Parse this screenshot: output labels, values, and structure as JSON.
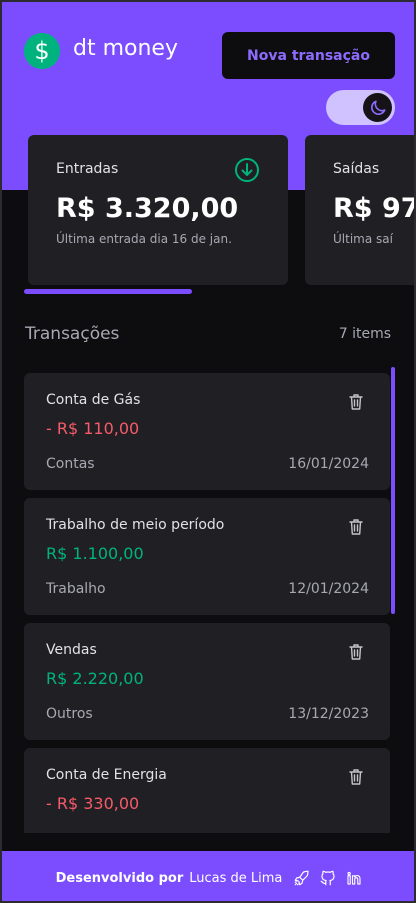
{
  "app": {
    "name": "dt money",
    "logo_symbol": "$"
  },
  "header": {
    "new_transaction_label": "Nova transação",
    "theme_toggle_icon": "moon-icon"
  },
  "summary": {
    "cards": [
      {
        "label": "Entradas",
        "value": "R$ 3.320,00",
        "sub": "Última entrada dia 16 de jan.",
        "icon": "arrow-down-circle-icon"
      },
      {
        "label": "Saídas",
        "value": "R$ 97",
        "sub": "Última saí"
      }
    ]
  },
  "transactions": {
    "title": "Transações",
    "count": "7 items",
    "items": [
      {
        "description": "Conta de Gás",
        "amount": "- R$ 110,00",
        "type": "out",
        "category": "Contas",
        "date": "16/01/2024"
      },
      {
        "description": "Trabalho de meio período",
        "amount": "R$ 1.100,00",
        "type": "in",
        "category": "Trabalho",
        "date": "12/01/2024"
      },
      {
        "description": "Vendas",
        "amount": "R$ 2.220,00",
        "type": "in",
        "category": "Outros",
        "date": "13/12/2023"
      },
      {
        "description": "Conta de Energia",
        "amount": "- R$ 330,00",
        "type": "out",
        "category": "",
        "date": ""
      }
    ]
  },
  "footer": {
    "lead": "Desenvolvido por",
    "name": "Lucas de Lima",
    "icons": [
      "rocket-icon",
      "github-icon",
      "linkedin-icon"
    ]
  },
  "colors": {
    "accent": "#7c4dff",
    "income": "#00b37e",
    "outcome": "#f75a68",
    "background": "#0d0d0f",
    "card": "#202024"
  }
}
